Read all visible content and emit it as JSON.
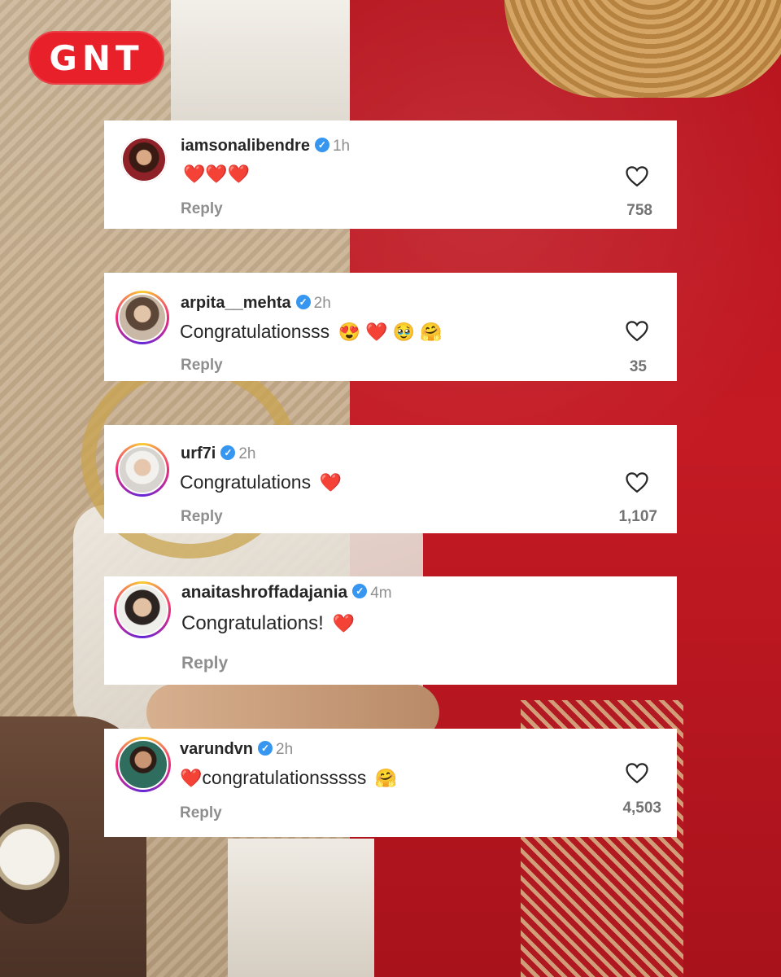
{
  "logo": {
    "text": "GNT",
    "color": "#e8202a"
  },
  "comments": [
    {
      "username": "iamsonalibendre",
      "time": "1h",
      "text": "",
      "emojis": "❤️❤️❤️",
      "reply": "Reply",
      "likes": "758"
    },
    {
      "username": "arpita__mehta",
      "time": "2h",
      "text": "Congratulationsss",
      "emojis": "😍 ❤️ 🥹 🤗",
      "reply": "Reply",
      "likes": "35"
    },
    {
      "username": "urf7i",
      "time": "2h",
      "text": "Congratulations",
      "emojis": "❤️",
      "reply": "Reply",
      "likes": "1,107"
    },
    {
      "username": "anaitashroffadajania",
      "time": "4m",
      "text": "Congratulations!",
      "emojis": "❤️",
      "reply": "Reply",
      "likes": ""
    },
    {
      "username": "varundvn",
      "time": "2h",
      "text": "congratulationsssss",
      "prefix_emoji": "❤️",
      "emojis": "🤗",
      "reply": "Reply",
      "likes": "4,503"
    }
  ],
  "colors": {
    "verified": "#3797f0",
    "heart": "#ee1d2f",
    "card_bg": "#ffffff",
    "muted_text": "#8e8e8e"
  }
}
